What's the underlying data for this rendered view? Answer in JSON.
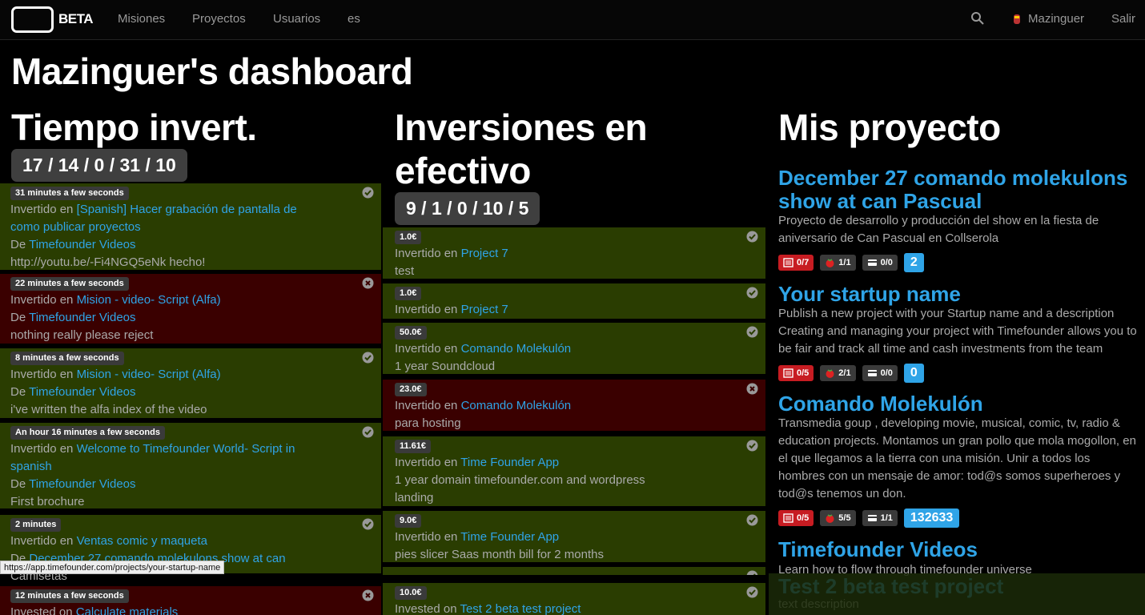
{
  "nav": {
    "brand": "BETA",
    "links": [
      "Misiones",
      "Proyectos",
      "Usuarios",
      "es"
    ],
    "user": "Mazinguer",
    "logout": "Salir"
  },
  "page_title": "Mazinguer's dashboard",
  "time_col": {
    "title": "Tiempo invert.",
    "stats": "17 / 14 / 0 / 31 / 10",
    "cards": [
      {
        "tag": "31 minutes a few seconds",
        "prefix": "Invertido en",
        "target": "[Spanish] Hacer grabación de pantalla de como publicar proyectos",
        "de": "De",
        "project": "Timefounder Videos",
        "note": "http://youtu.be/-Fi4NGQ5eNk hecho!",
        "status": "ok"
      },
      {
        "tag": "22 minutes a few seconds",
        "prefix": "Invertido en",
        "target": "Mision - video- Script (Alfa)",
        "de": "De",
        "project": "Timefounder Videos",
        "note": "nothing really please reject",
        "status": "rej"
      },
      {
        "tag": "8 minutes a few seconds",
        "prefix": "Invertido en",
        "target": "Mision - video- Script (Alfa)",
        "de": "De",
        "project": "Timefounder Videos",
        "note": "i've written the alfa index of the video",
        "status": "ok"
      },
      {
        "tag": "An hour 16 minutes a few seconds",
        "prefix": "Invertido en",
        "target": "Welcome to Timefounder World- Script in spanish",
        "de": "De",
        "project": "Timefounder Videos",
        "note": "First brochure",
        "status": "ok"
      },
      {
        "tag": "2 minutes",
        "prefix": "Invertido en",
        "target": "Ventas comic y maqueta",
        "de": "De",
        "project": "December 27 comando molekulons show at can",
        "note": "Camisetas",
        "status": "ok"
      },
      {
        "tag": "12 minutes a few seconds",
        "prefix": "Invested on",
        "target": "Calculate materials",
        "de": "",
        "project": "",
        "note": "",
        "status": "rej"
      }
    ]
  },
  "cash_col": {
    "title_line1": "Inversiones en",
    "title_line2": "efectivo",
    "stats": "9 / 1 / 0 / 10 / 5",
    "cards": [
      {
        "tag": "1.0€",
        "prefix": "Invertido en",
        "target": "Project 7",
        "note": "test",
        "status": "ok"
      },
      {
        "tag": "1.0€",
        "prefix": "Invertido en",
        "target": "Project 7",
        "note": "",
        "status": "ok"
      },
      {
        "tag": "50.0€",
        "prefix": "Invertido en",
        "target": "Comando Molekulón",
        "note": "1 year Soundcloud",
        "status": "ok"
      },
      {
        "tag": "23.0€",
        "prefix": "Invertido en",
        "target": "Comando Molekulón",
        "note": "para hosting",
        "status": "rej"
      },
      {
        "tag": "11.61€",
        "prefix": "Invertido en",
        "target": "Time Founder App",
        "note": "1 year domain timefounder.com and wordpress landing",
        "status": "ok"
      },
      {
        "tag": "9.0€",
        "prefix": "Invertido en",
        "target": "Time Founder App",
        "note": "pies slicer Saas month bill for 2 months",
        "status": "ok"
      },
      {
        "tag": "",
        "prefix": "",
        "target": "",
        "note": "",
        "status": "ok"
      },
      {
        "tag": "10.0€",
        "prefix": "Invested on",
        "target": "Test 2 beta test project",
        "note": "",
        "status": "ok"
      }
    ]
  },
  "projects_col": {
    "title": "Mis proyecto",
    "projects": [
      {
        "title": "December 27 comando molekulons show at can Pascual",
        "desc": "Proyecto de desarrollo y producción del show en la fiesta de aniversario de Can Pascual en Collserola",
        "tasks": "0/7",
        "members": "1/1",
        "cash": "0/0",
        "count": "2"
      },
      {
        "title": "Your startup name",
        "desc": "Publish a new project with your Startup name and a description Creating and managing your project with Timefounder allows you to be fair and track all time and cash investments from the team",
        "tasks": "0/5",
        "members": "2/1",
        "cash": "0/0",
        "count": "0"
      },
      {
        "title": "Comando Molekulón",
        "desc": "Transmedia goup , developing movie, musical, comic, tv, radio & education projects. Montamos un gran pollo que mola mogollon, en el que llegamos a la tierra con una misión. Unir a todos los hombres con un mensaje de amor: tod@s somos superheroes y tod@s tenemos un don.",
        "tasks": "0/5",
        "members": "5/5",
        "cash": "1/1",
        "count": "132633"
      },
      {
        "title": "Timefounder Videos",
        "desc": "Learn how to flow through timefounder universe"
      },
      {
        "title": "Test 2 beta test project",
        "desc": "text description"
      }
    ]
  },
  "status_url": "https://app.timefounder.com/projects/your-startup-name",
  "colors": {
    "accent": "#2fa4e7",
    "ok": "#2a3d01",
    "rejected": "#3a0000",
    "badge_red": "#c71c22"
  }
}
